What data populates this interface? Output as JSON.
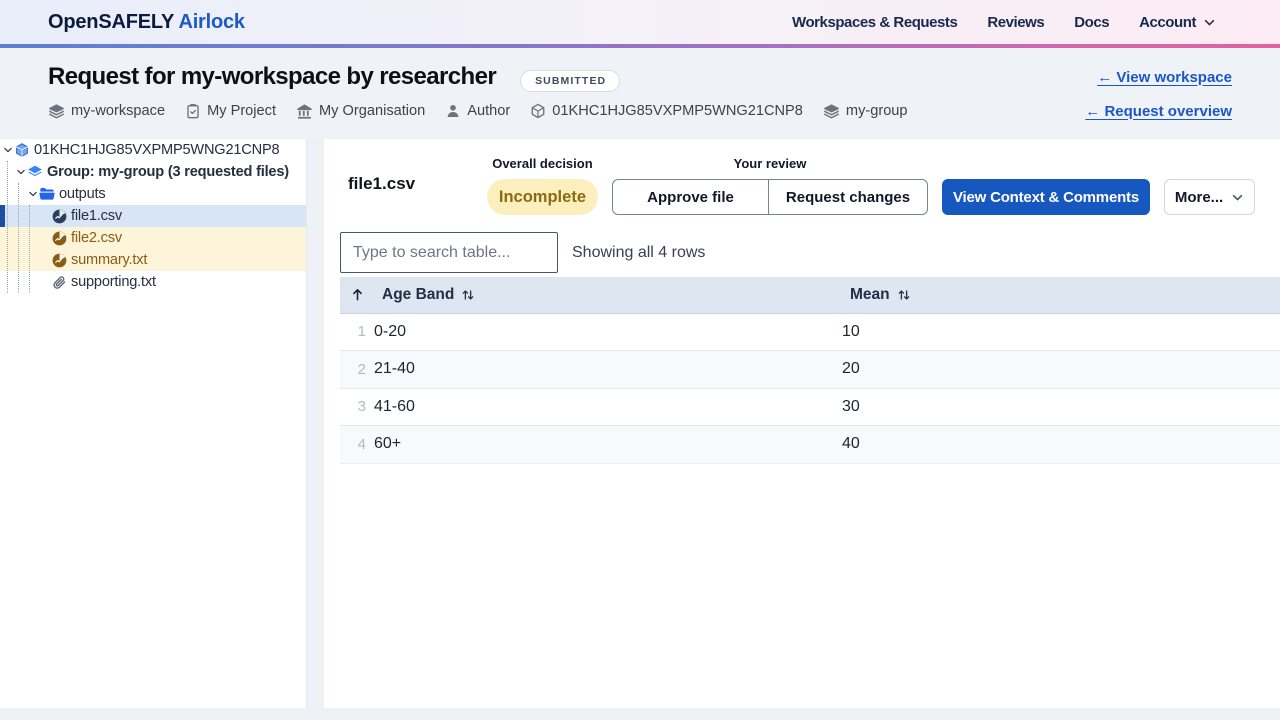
{
  "brand": {
    "name_primary": "OpenSAFELY",
    "name_secondary": "Airlock"
  },
  "nav": {
    "items": [
      {
        "label": "Workspaces & Requests"
      },
      {
        "label": "Reviews"
      },
      {
        "label": "Docs"
      },
      {
        "label": "Account"
      }
    ]
  },
  "header": {
    "title": "Request for my-workspace by researcher",
    "status_badge": "SUBMITTED",
    "view_workspace_link": "← View workspace",
    "request_overview_link": "← Request overview",
    "meta": [
      {
        "icon": "layers-icon",
        "label": "my-workspace"
      },
      {
        "icon": "clipboard-icon",
        "label": "My Project"
      },
      {
        "icon": "bank-icon",
        "label": "My Organisation"
      },
      {
        "icon": "person-icon",
        "label": "Author"
      },
      {
        "icon": "cube-icon",
        "label": "01KHC1HJG85VXPMP5WNG21CNP8"
      },
      {
        "icon": "layers-icon",
        "label": "my-group"
      }
    ]
  },
  "tree": {
    "root": {
      "label": "01KHC1HJG85VXPMP5WNG21CNP8"
    },
    "group": {
      "label": "Group: my-group (3 requested files)"
    },
    "folder": {
      "label": "outputs"
    },
    "files": [
      {
        "label": "file1.csv",
        "state": "selected"
      },
      {
        "label": "file2.csv",
        "state": "changes-requested"
      },
      {
        "label": "summary.txt",
        "state": "changes-requested"
      },
      {
        "label": "supporting.txt",
        "state": "supporting"
      }
    ]
  },
  "file_panel": {
    "title": "file1.csv",
    "decision_label": "Overall decision",
    "decision_value": "Incomplete",
    "review_label": "Your review",
    "approve_button": "Approve file",
    "request_changes_button": "Request changes",
    "view_context_button": "View Context & Comments",
    "more_button": "More..."
  },
  "table_toolbar": {
    "search_placeholder": "Type to search table...",
    "row_count_text": "Showing all 4 rows"
  },
  "table": {
    "columns": [
      "Age Band",
      "Mean"
    ],
    "rows": [
      {
        "index": "1",
        "age_band": "0-20",
        "mean": "10"
      },
      {
        "index": "2",
        "age_band": "21-40",
        "mean": "20"
      },
      {
        "index": "3",
        "age_band": "41-60",
        "mean": "30"
      },
      {
        "index": "4",
        "age_band": "60+",
        "mean": "40"
      }
    ]
  },
  "colors": {
    "primary_blue": "#1658c0",
    "link_blue": "#1b56c9",
    "selected_row_bg": "#d8e5f7",
    "selected_row_bar": "#1d4fa1",
    "warn_row_bg": "#fdf5da",
    "warn_text": "#8a5c14",
    "incomplete_badge_bg": "#fbf0bd",
    "incomplete_badge_text": "#8d6a11",
    "table_header_bg": "#dde6f1"
  }
}
